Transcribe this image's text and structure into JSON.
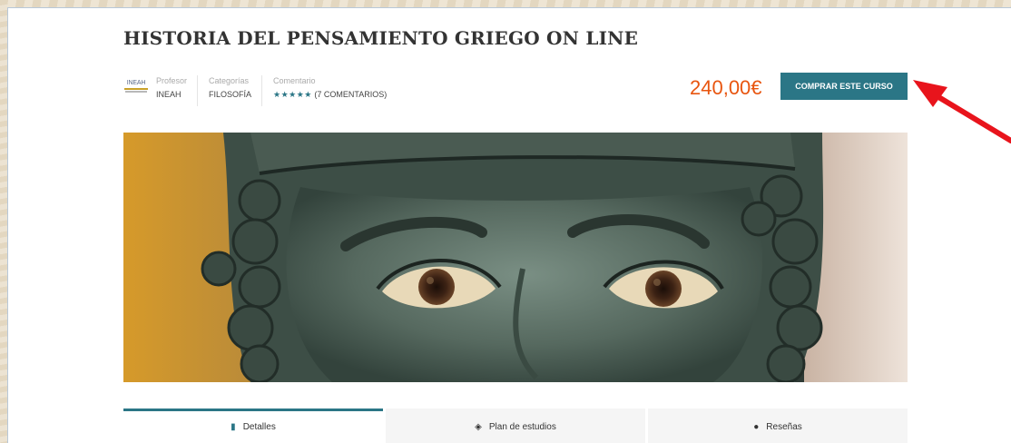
{
  "course": {
    "title": "HISTORIA DEL PENSAMIENTO GRIEGO ON LINE",
    "logo_text": "INEAH",
    "meta": [
      {
        "label": "Profesor",
        "value": "INEAH"
      },
      {
        "label": "Categorías",
        "value": "FILOSOFÍA"
      },
      {
        "label": "Comentario",
        "stars": "★★★★★",
        "value": "(7 COMENTARIOS)"
      }
    ],
    "price": "240,00€",
    "buy_label": "COMPRAR ESTE CURSO"
  },
  "tabs": [
    {
      "label": "Detalles",
      "icon": "bookmark-icon",
      "active": true
    },
    {
      "label": "Plan de estudios",
      "icon": "cube-icon",
      "active": false
    },
    {
      "label": "Reseñas",
      "icon": "comments-icon",
      "active": false
    }
  ],
  "colors": {
    "accent": "#2b7686",
    "price": "#e8550f",
    "arrow": "#e8141c"
  }
}
